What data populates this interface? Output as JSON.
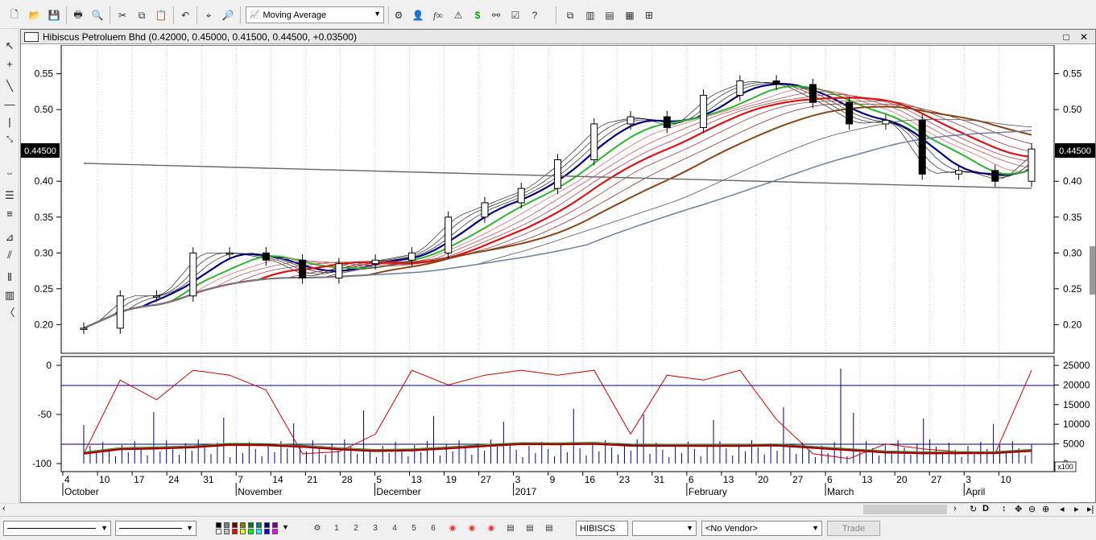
{
  "toolbar": {
    "indicator": "Moving Average",
    "buttons": [
      "new-icon",
      "open-icon",
      "save-icon",
      "print-icon",
      "print-preview-icon",
      "cut-icon",
      "copy-icon",
      "paste-icon",
      "undo-icon",
      "crosshair-icon",
      "zoom-icon"
    ],
    "right_buttons": [
      "indicator-builder-icon",
      "user-icon",
      "function-icon",
      "alert-icon",
      "dollar-icon",
      "binoculars-icon",
      "help-icon"
    ],
    "layout_buttons": [
      "cascade-icon",
      "tile-vertical-icon",
      "tile-horizontal-icon",
      "tile-grid-icon",
      "arrange-icon"
    ]
  },
  "window": {
    "title": "Hibiscus Petroluem Bhd (0.42000, 0.45000, 0.41500, 0.44500, +0.03500)",
    "current_price": "0.44500"
  },
  "price_axis": [
    "0.55",
    "0.50",
    "0.40",
    "0.35",
    "0.30",
    "0.25",
    "0.20"
  ],
  "oscillator_left_axis": [
    "0",
    "-50",
    "-100"
  ],
  "oscillator_right_axis": [
    "25000",
    "20000",
    "15000",
    "10000",
    "5000",
    "0"
  ],
  "volume_multiplier": "x100",
  "date_axis": {
    "days": [
      "4",
      "10",
      "17",
      "24",
      "31",
      "7",
      "14",
      "21",
      "28",
      "5",
      "13",
      "19",
      "27",
      "3",
      "9",
      "16",
      "23",
      "31",
      "6",
      "13",
      "20",
      "27",
      "6",
      "13",
      "20",
      "27",
      "3",
      "10"
    ],
    "months": [
      "October",
      "November",
      "December",
      "2017",
      "February",
      "March",
      "April"
    ]
  },
  "chart_data": [
    {
      "type": "candlestick",
      "title": "Hibiscus Petroluem Bhd",
      "ylim": [
        0.16,
        0.59
      ],
      "x": [
        "2016-10-04",
        "2016-10-10",
        "2016-10-17",
        "2016-10-24",
        "2016-10-31",
        "2016-11-07",
        "2016-11-14",
        "2016-11-21",
        "2016-11-28",
        "2016-12-05",
        "2016-12-13",
        "2016-12-19",
        "2016-12-27",
        "2017-01-03",
        "2017-01-09",
        "2017-01-16",
        "2017-01-23",
        "2017-01-31",
        "2017-02-06",
        "2017-02-13",
        "2017-02-20",
        "2017-02-27",
        "2017-03-06",
        "2017-03-13",
        "2017-03-20",
        "2017-03-27",
        "2017-03-31"
      ],
      "close": [
        0.195,
        0.24,
        0.24,
        0.3,
        0.3,
        0.29,
        0.265,
        0.285,
        0.29,
        0.3,
        0.35,
        0.37,
        0.39,
        0.43,
        0.48,
        0.49,
        0.475,
        0.52,
        0.54,
        0.535,
        0.51,
        0.48,
        0.485,
        0.41,
        0.415,
        0.4,
        0.445
      ],
      "last_bar": {
        "open": 0.42,
        "high": 0.45,
        "low": 0.415,
        "close": 0.445
      }
    },
    {
      "type": "line",
      "title": "Oscillator",
      "ylim": [
        -100,
        0
      ],
      "values": [
        -90,
        -15,
        -35,
        -5,
        -10,
        -25,
        -90,
        -88,
        -70,
        -5,
        -20,
        -10,
        -5,
        -10,
        -5,
        -70,
        -10,
        -15,
        -5,
        -55,
        -90,
        -95,
        -80,
        -85,
        -88,
        -90,
        -5
      ]
    }
  ],
  "status": {
    "symbol": "HIBISCS",
    "vendor": "<No Vendor>",
    "trade_label": "Trade",
    "colors": [
      "#000000",
      "#808080",
      "#800000",
      "#808000",
      "#008000",
      "#008080",
      "#000080",
      "#800080",
      "#ffffff",
      "#c0c0c0",
      "#ff0000",
      "#ffff00",
      "#00ff00",
      "#00ffff",
      "#0000ff",
      "#ff00ff"
    ],
    "scroll_right": "D"
  }
}
